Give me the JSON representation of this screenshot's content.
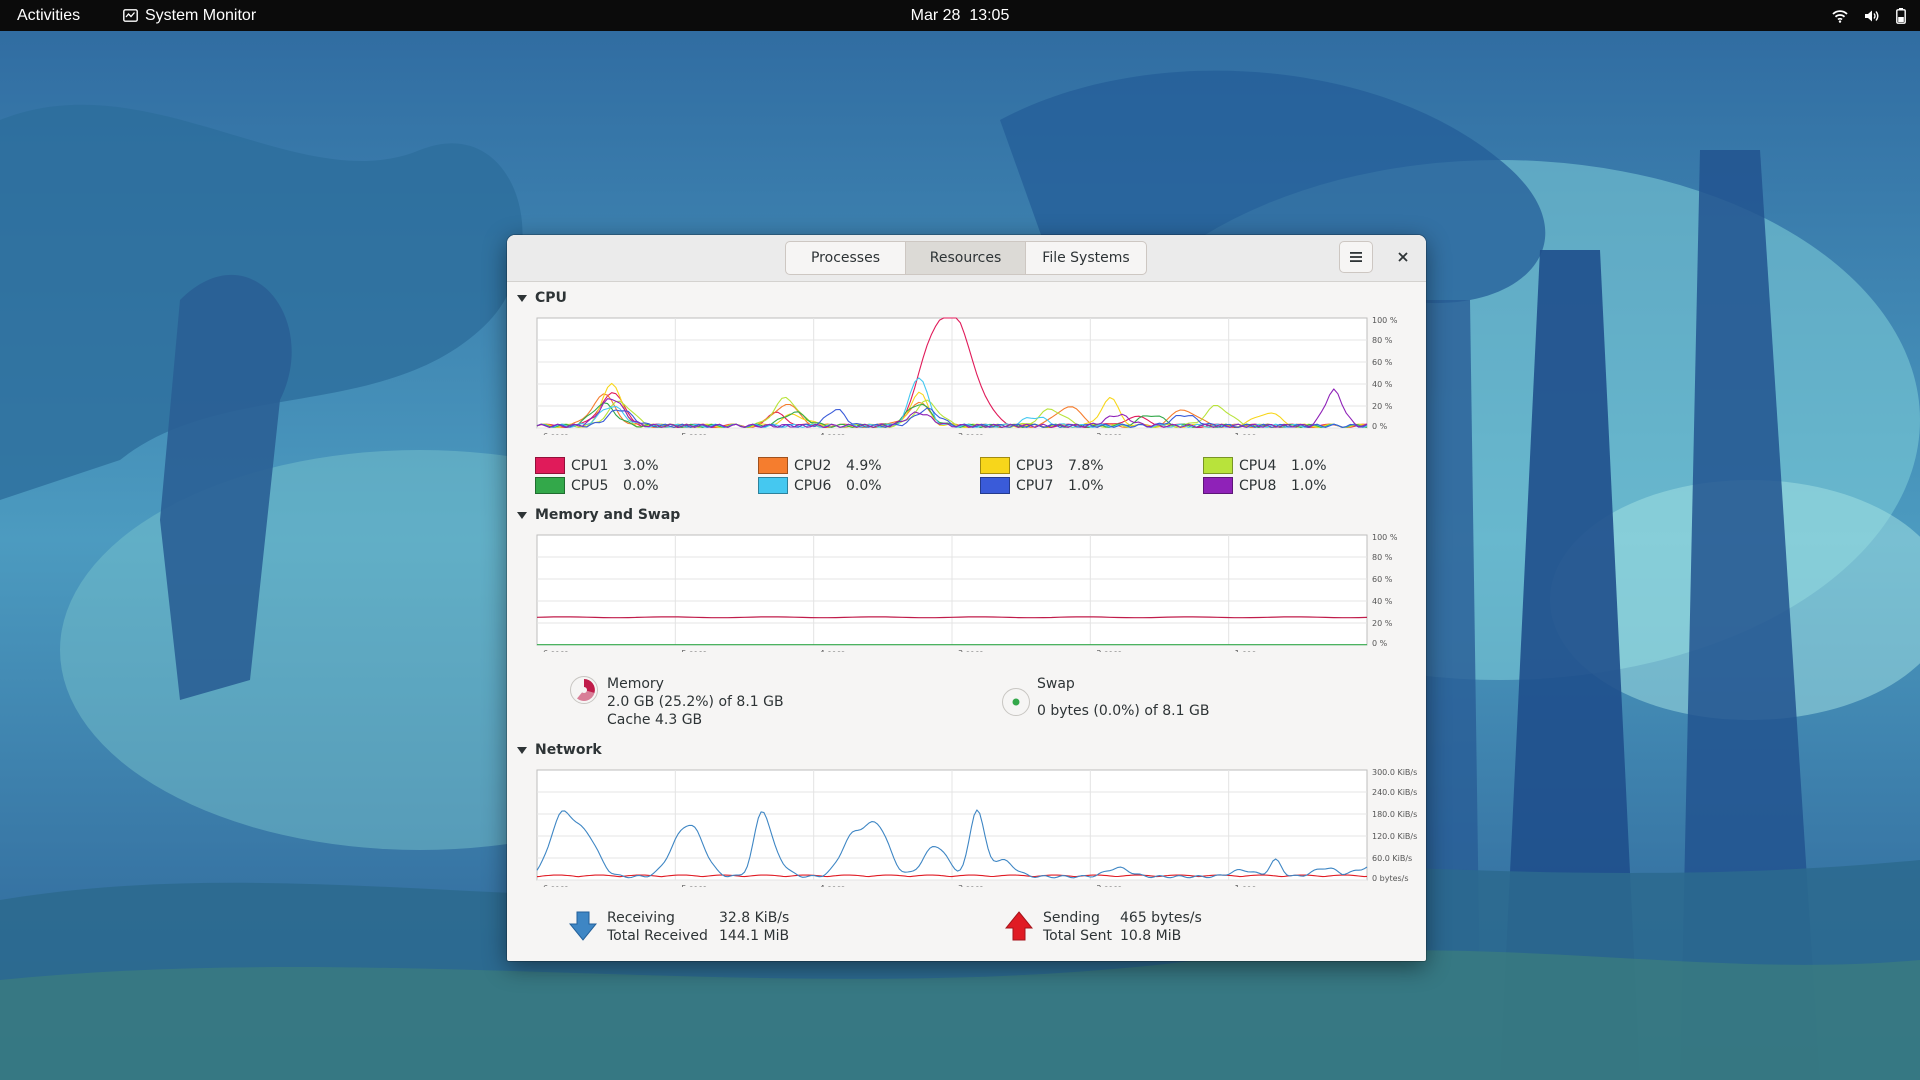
{
  "topbar": {
    "activities": "Activities",
    "app_name": "System Monitor",
    "clock": "Mar 28  13:05"
  },
  "window": {
    "tabs": [
      "Processes",
      "Resources",
      "File Systems"
    ],
    "active_tab": "Resources"
  },
  "time_labels": [
    "6 secs",
    "5 secs",
    "4 secs",
    "3 secs",
    "2 secs",
    "1 sec"
  ],
  "cpu": {
    "title": "CPU",
    "axis": [
      "100 %",
      "80 %",
      "60 %",
      "40 %",
      "20 %",
      "0 %"
    ],
    "cores": [
      {
        "name": "CPU1",
        "value": "3.0%",
        "color": "#e01b5a"
      },
      {
        "name": "CPU2",
        "value": "4.9%",
        "color": "#f57d2e"
      },
      {
        "name": "CPU3",
        "value": "7.8%",
        "color": "#f7d61b"
      },
      {
        "name": "CPU4",
        "value": "1.0%",
        "color": "#b8e33b"
      },
      {
        "name": "CPU5",
        "value": "0.0%",
        "color": "#33a84a"
      },
      {
        "name": "CPU6",
        "value": "0.0%",
        "color": "#45c8f0"
      },
      {
        "name": "CPU7",
        "value": "1.0%",
        "color": "#3a5bd9"
      },
      {
        "name": "CPU8",
        "value": "1.0%",
        "color": "#8f22b8"
      }
    ]
  },
  "memory": {
    "title": "Memory and Swap",
    "axis": [
      "100 %",
      "80 %",
      "60 %",
      "40 %",
      "20 %",
      "0 %"
    ],
    "memory_label": "Memory",
    "memory_value": "2.0 GB (25.2%) of 8.1 GB",
    "cache_value": "Cache 4.3 GB",
    "swap_label": "Swap",
    "swap_value": "0 bytes (0.0%) of 8.1 GB",
    "memory_color": "#c01c4a",
    "swap_color": "#33a84a"
  },
  "network": {
    "title": "Network",
    "axis": [
      "300.0 KiB/s",
      "240.0 KiB/s",
      "180.0 KiB/s",
      "120.0 KiB/s",
      "60.0 KiB/s",
      "0 bytes/s"
    ],
    "receiving_label": "Receiving",
    "receiving_value": "32.8 KiB/s",
    "total_received_label": "Total Received",
    "total_received_value": "144.1 MiB",
    "sending_label": "Sending",
    "sending_value": "465 bytes/s",
    "total_sent_label": "Total Sent",
    "total_sent_value": "10.8 MiB",
    "receive_color": "#3e86c4",
    "send_color": "#e01b24"
  }
}
